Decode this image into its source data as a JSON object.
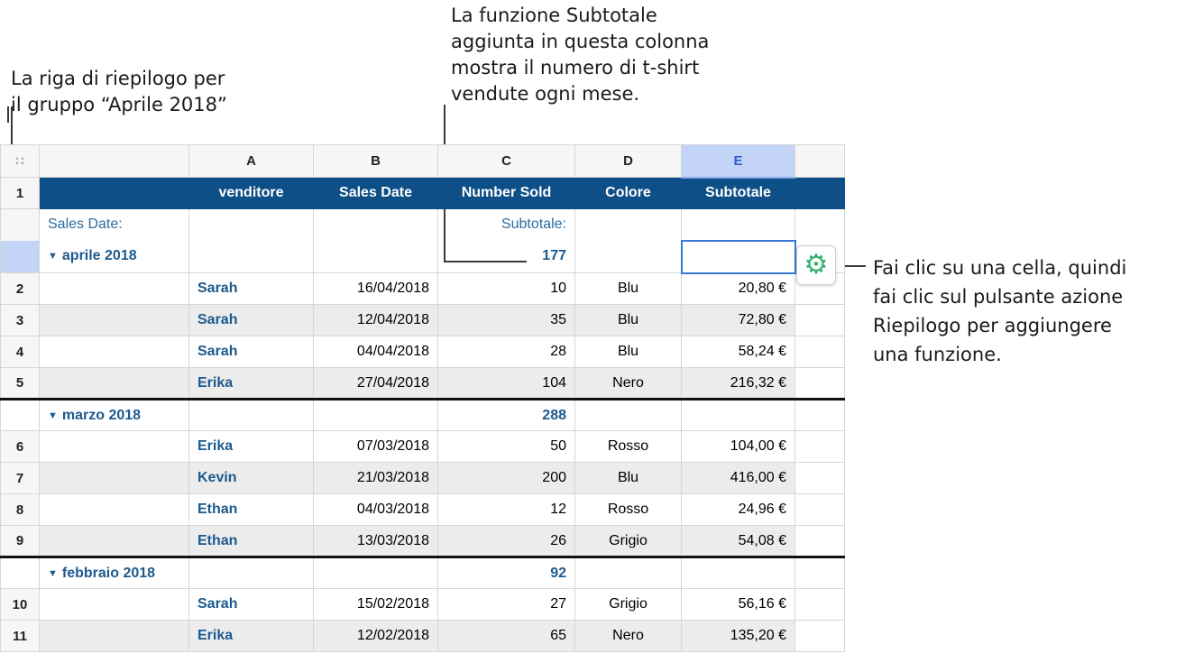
{
  "annotations": {
    "left_lines": [
      "La riga di riepilogo per",
      "il gruppo “Aprile 2018”"
    ],
    "top_lines": [
      "La funzione Subtotale",
      "aggiunta in questa colonna",
      "mostra il numero di t-shirt",
      "vendute ogni mese."
    ],
    "right_lines": [
      "Fai clic su una cella, quindi",
      "fai clic sul pulsante azione",
      "Riepilogo per aggiungere",
      "una funzione."
    ]
  },
  "sheet": {
    "corner_icon": "grid-dots-icon",
    "corner_glyph": "∷",
    "columns": [
      "A",
      "B",
      "C",
      "D",
      "E"
    ],
    "header": [
      "venditore",
      "Sales Date",
      "Number Sold",
      "Colore",
      "Subtotale"
    ],
    "summary_label_a": "Sales Date:",
    "summary_label_c": "Subtotale:",
    "groups": [
      {
        "label": "aprile 2018",
        "subtotal": "177",
        "rows": [
          {
            "n": "2",
            "seller": "Sarah",
            "date": "16/04/2018",
            "sold": "10",
            "color": "Blu",
            "subtotal": "20,80 €"
          },
          {
            "n": "3",
            "seller": "Sarah",
            "date": "12/04/2018",
            "sold": "35",
            "color": "Blu",
            "subtotal": "72,80 €"
          },
          {
            "n": "4",
            "seller": "Sarah",
            "date": "04/04/2018",
            "sold": "28",
            "color": "Blu",
            "subtotal": "58,24 €"
          },
          {
            "n": "5",
            "seller": "Erika",
            "date": "27/04/2018",
            "sold": "104",
            "color": "Nero",
            "subtotal": "216,32 €"
          }
        ]
      },
      {
        "label": "marzo 2018",
        "subtotal": "288",
        "rows": [
          {
            "n": "6",
            "seller": "Erika",
            "date": "07/03/2018",
            "sold": "50",
            "color": "Rosso",
            "subtotal": "104,00 €"
          },
          {
            "n": "7",
            "seller": "Kevin",
            "date": "21/03/2018",
            "sold": "200",
            "color": "Blu",
            "subtotal": "416,00 €"
          },
          {
            "n": "8",
            "seller": "Ethan",
            "date": "04/03/2018",
            "sold": "12",
            "color": "Rosso",
            "subtotal": "24,96 €"
          },
          {
            "n": "9",
            "seller": "Ethan",
            "date": "13/03/2018",
            "sold": "26",
            "color": "Grigio",
            "subtotal": "54,08 €"
          }
        ]
      },
      {
        "label": "febbraio 2018",
        "subtotal": "92",
        "rows": [
          {
            "n": "10",
            "seller": "Sarah",
            "date": "15/02/2018",
            "sold": "27",
            "color": "Grigio",
            "subtotal": "56,16 €"
          },
          {
            "n": "11",
            "seller": "Erika",
            "date": "12/02/2018",
            "sold": "65",
            "color": "Nero",
            "subtotal": "135,20 €"
          }
        ]
      }
    ],
    "header_row_number": "1",
    "gear_icon": "gear-icon",
    "gear_glyph": "⚙",
    "triangle_glyph": "▼",
    "colors": {
      "header_bg": "#0d4f86",
      "selected_col": "#c3d4f7",
      "group_text": "#1c5a8e",
      "gear": "#33b36b"
    }
  }
}
